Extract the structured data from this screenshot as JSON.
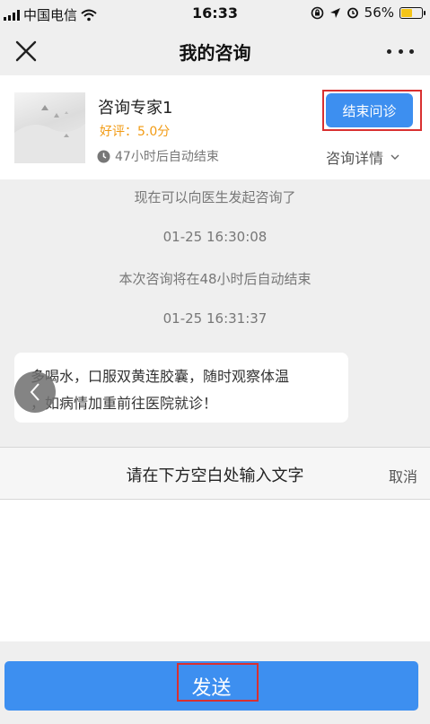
{
  "status_bar": {
    "carrier": "中国电信",
    "time": "16:33",
    "battery_percent": "56%",
    "battery_level": 0.56
  },
  "navbar": {
    "title": "我的咨询"
  },
  "doctor": {
    "name": "咨询专家1",
    "rating": "好评：5.0分",
    "auto_end_notice": "47小时后自动结束",
    "end_button": "结束问诊",
    "details_label": "咨询详情"
  },
  "chat": {
    "system_messages": [
      "现在可以向医生发起咨询了",
      "01-25 16:30:08",
      "本次咨询将在48小时后自动结束",
      "01-25 16:31:37"
    ],
    "doctor_message_line1": "多喝水，口服双黄连胶囊，随时观察体温",
    "doctor_message_line2": "，如病情加重前往医院就诊！"
  },
  "input": {
    "prompt": "请在下方空白处输入文字",
    "cancel_label": "取消",
    "value": ""
  },
  "send_button": "发送",
  "colors": {
    "accent": "#3d8ff0",
    "rating": "#f29b14",
    "highlight": "#d93030",
    "background": "#efefef"
  }
}
